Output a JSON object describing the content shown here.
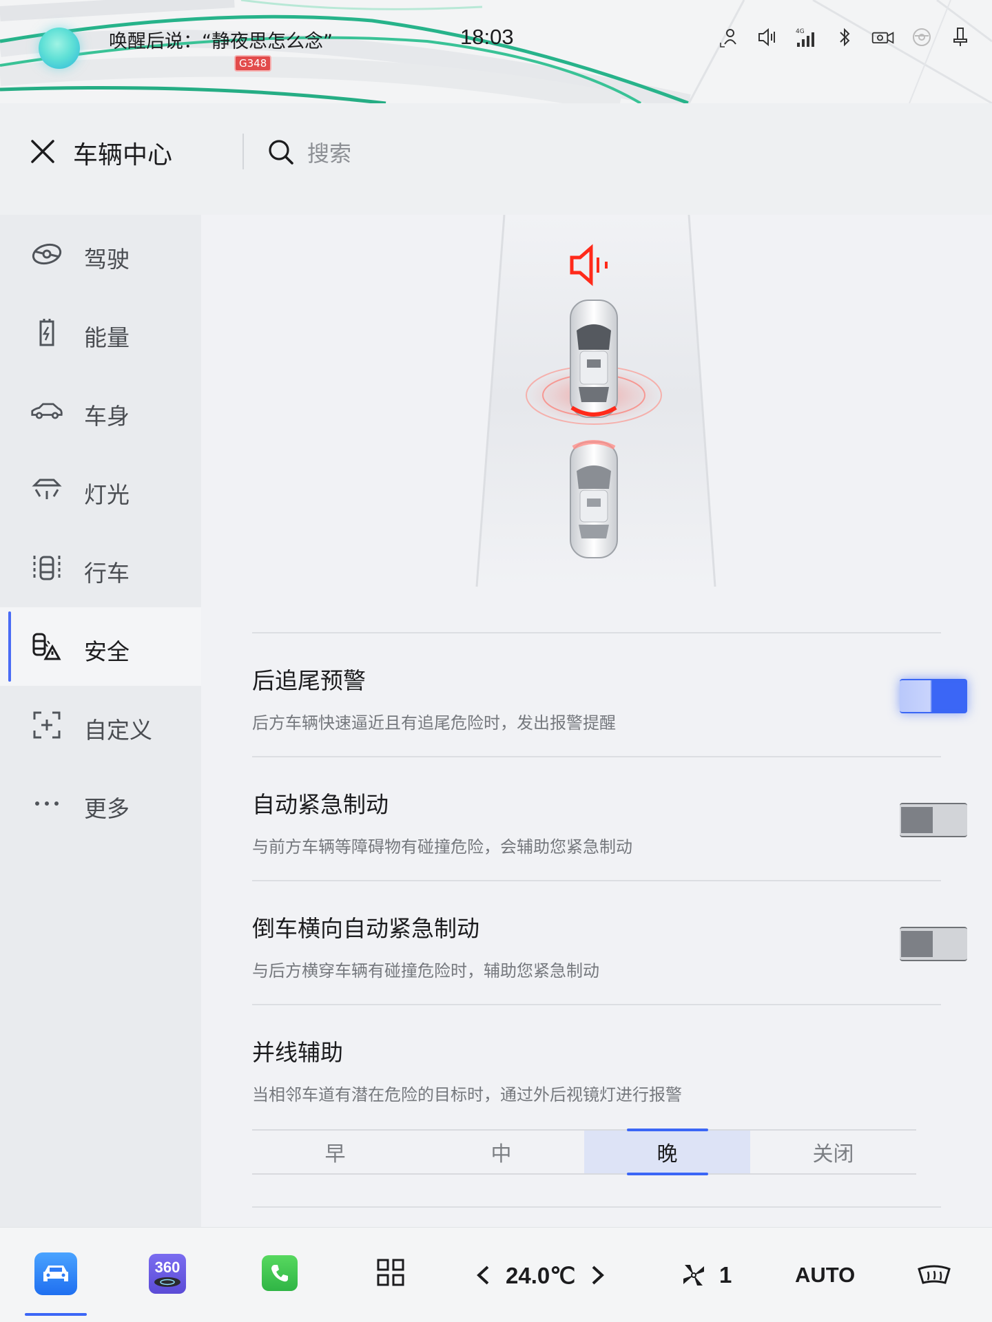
{
  "status_bar": {
    "voice_hint": "唤醒后说：“静夜思怎么念”",
    "road_badge": "G348",
    "time": "18:03",
    "icons": [
      "user-profile-icon",
      "volume-icon",
      "4g-signal-icon",
      "bluetooth-icon",
      "camera-icon",
      "steering-icon",
      "usb-icon"
    ],
    "signal_label": "4G"
  },
  "header": {
    "title": "车辆中心",
    "search_placeholder": "搜索"
  },
  "sidebar": {
    "items": [
      {
        "label": "驾驶",
        "icon": "steering-wheel-icon",
        "active": false
      },
      {
        "label": "能量",
        "icon": "battery-charge-icon",
        "active": false
      },
      {
        "label": "车身",
        "icon": "car-body-icon",
        "active": false
      },
      {
        "label": "灯光",
        "icon": "headlight-icon",
        "active": false
      },
      {
        "label": "行车",
        "icon": "lane-icon",
        "active": false
      },
      {
        "label": "安全",
        "icon": "safety-icon",
        "active": true
      },
      {
        "label": "自定义",
        "icon": "custom-icon",
        "active": false
      },
      {
        "label": "更多",
        "icon": "more-icon",
        "active": false
      }
    ]
  },
  "settings": {
    "rear_collision": {
      "title": "后追尾预警",
      "desc": "后方车辆快速逼近且有追尾危险时，发出报警提醒",
      "enabled": true
    },
    "aeb": {
      "title": "自动紧急制动",
      "desc": "与前方车辆等障碍物有碰撞危险，会辅助您紧急制动",
      "enabled": false
    },
    "rcta": {
      "title": "倒车横向自动紧急制动",
      "desc": "与后方横穿车辆有碰撞危险时，辅助您紧急制动",
      "enabled": false
    },
    "lane_assist": {
      "title": "并线辅助",
      "desc": "当相邻车道有潜在危险的目标时，通过外后视镜灯进行报警",
      "options": [
        "早",
        "中",
        "晚",
        "关闭"
      ],
      "selected": "晚"
    }
  },
  "dock": {
    "app_360_label": "360",
    "temperature": "24.0℃",
    "fan_level": "1",
    "climate_mode": "AUTO"
  },
  "colors": {
    "accent": "#3b66f6",
    "alert": "#ff2a1a"
  }
}
